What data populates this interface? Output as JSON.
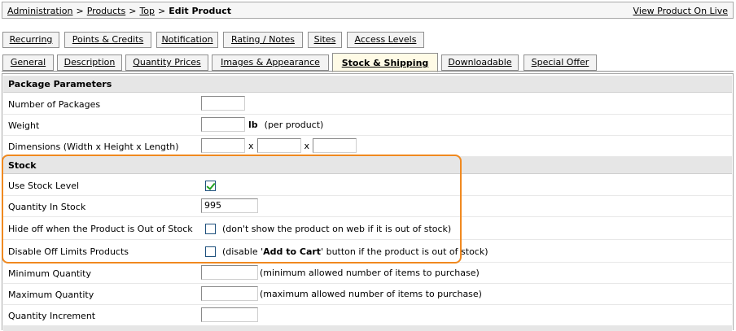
{
  "breadcrumb": {
    "items": [
      "Administration",
      "Products",
      "Top"
    ],
    "separator": ">",
    "current": "Edit Product"
  },
  "view_live_label": "View Product On Live",
  "tabs_row1": [
    {
      "label": "Recurring"
    },
    {
      "label": "Points & Credits"
    },
    {
      "label": "Notification"
    },
    {
      "label": "Rating / Notes"
    },
    {
      "label": "Sites"
    },
    {
      "label": "Access Levels"
    }
  ],
  "tabs_row2": [
    {
      "label": "General"
    },
    {
      "label": "Description"
    },
    {
      "label": "Quantity Prices"
    },
    {
      "label": "Images & Appearance"
    },
    {
      "label": "Stock & Shipping",
      "active": true
    },
    {
      "label": "Downloadable"
    },
    {
      "label": "Special Offer"
    }
  ],
  "package": {
    "title": "Package Parameters",
    "number_of_packages": {
      "label": "Number of Packages",
      "value": ""
    },
    "weight": {
      "label": "Weight",
      "value": "",
      "unit": "lb",
      "hint": "(per product)"
    },
    "dimensions": {
      "label": "Dimensions (Width x Height x Length)",
      "width": "",
      "height": "",
      "length": "",
      "separator": "x"
    }
  },
  "stock": {
    "title": "Stock",
    "use_stock_level": {
      "label": "Use Stock Level",
      "checked": true
    },
    "quantity_in_stock": {
      "label": "Quantity In Stock",
      "value": "995"
    },
    "hide_out_of_stock": {
      "label": "Hide off when the Product is Out of Stock",
      "checked": false,
      "hint": "(don't show the product on web if it is out of stock)"
    },
    "disable_off_limits": {
      "label": "Disable Off Limits Products",
      "checked": false,
      "hint_pre": "(disable '",
      "hint_bold": "Add to Cart",
      "hint_post": "' button if the product is out of stock)"
    },
    "minimum_quantity": {
      "label": "Minimum Quantity",
      "value": "",
      "hint": "(minimum allowed number of items to purchase)"
    },
    "maximum_quantity": {
      "label": "Maximum Quantity",
      "value": "",
      "hint": "(maximum allowed number of items to purchase)"
    },
    "quantity_increment": {
      "label": "Quantity Increment",
      "value": ""
    }
  },
  "colors": {
    "highlight": "#f0891f",
    "checkmark": "#21a121",
    "active_tab": "#fffbe6"
  }
}
